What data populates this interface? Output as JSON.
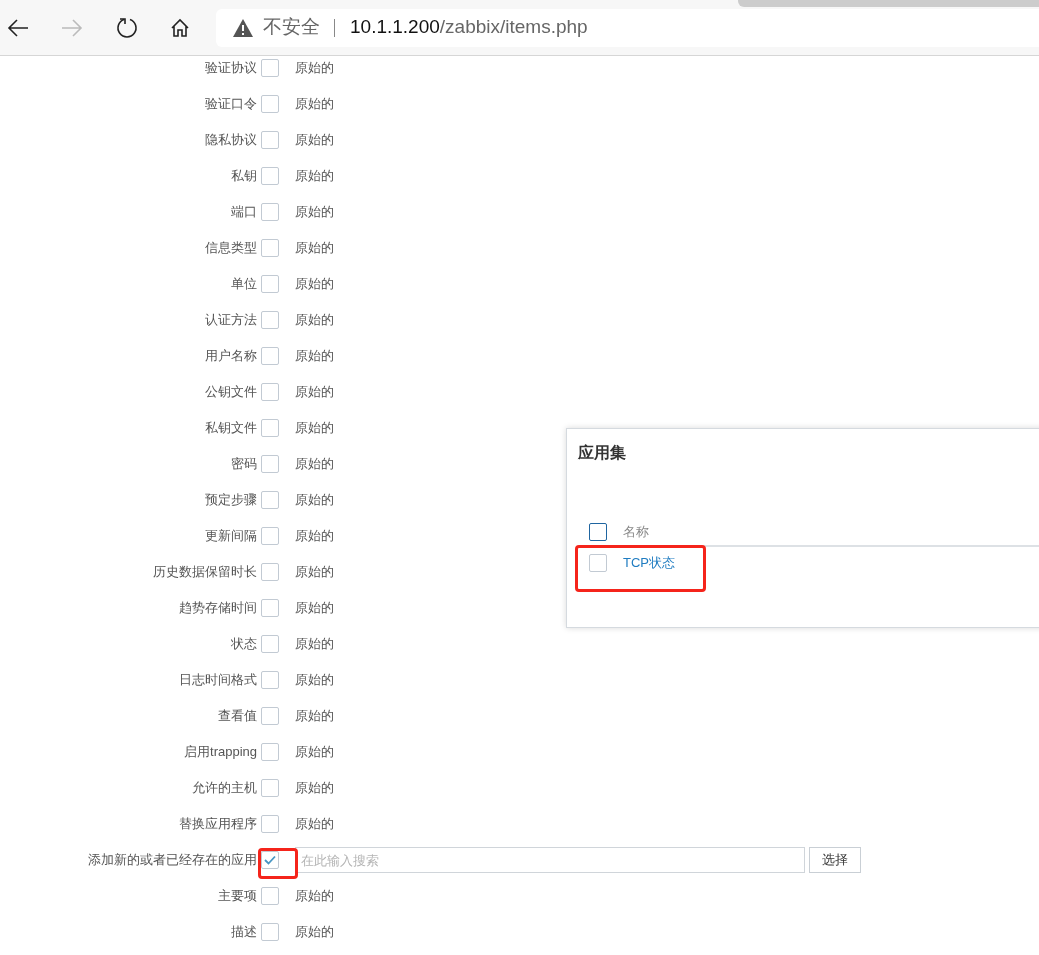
{
  "browser": {
    "security": "不安全",
    "url_host": "10.1.1.200",
    "url_path": "/zabbix/items.php"
  },
  "form": {
    "rows": [
      {
        "kind": "original",
        "label": "验证协议",
        "checked": false,
        "value": "原始的"
      },
      {
        "kind": "original",
        "label": "验证口令",
        "checked": false,
        "value": "原始的"
      },
      {
        "kind": "original",
        "label": "隐私协议",
        "checked": false,
        "value": "原始的"
      },
      {
        "kind": "original",
        "label": "私钥",
        "checked": false,
        "value": "原始的"
      },
      {
        "kind": "original",
        "label": "端口",
        "checked": false,
        "value": "原始的"
      },
      {
        "kind": "original",
        "label": "信息类型",
        "checked": false,
        "value": "原始的"
      },
      {
        "kind": "original",
        "label": "单位",
        "checked": false,
        "value": "原始的"
      },
      {
        "kind": "original",
        "label": "认证方法",
        "checked": false,
        "value": "原始的"
      },
      {
        "kind": "original",
        "label": "用户名称",
        "checked": false,
        "value": "原始的"
      },
      {
        "kind": "original",
        "label": "公钥文件",
        "checked": false,
        "value": "原始的"
      },
      {
        "kind": "original",
        "label": "私钥文件",
        "checked": false,
        "value": "原始的"
      },
      {
        "kind": "original",
        "label": "密码",
        "checked": false,
        "value": "原始的"
      },
      {
        "kind": "original",
        "label": "预定步骤",
        "checked": false,
        "value": "原始的"
      },
      {
        "kind": "original",
        "label": "更新间隔",
        "checked": false,
        "value": "原始的"
      },
      {
        "kind": "original",
        "label": "历史数据保留时长",
        "checked": false,
        "value": "原始的"
      },
      {
        "kind": "original",
        "label": "趋势存储时间",
        "checked": false,
        "value": "原始的"
      },
      {
        "kind": "original",
        "label": "状态",
        "checked": false,
        "value": "原始的"
      },
      {
        "kind": "original",
        "label": "日志时间格式",
        "checked": false,
        "value": "原始的"
      },
      {
        "kind": "original",
        "label": "查看值",
        "checked": false,
        "value": "原始的"
      },
      {
        "kind": "original",
        "label": "启用trapping",
        "checked": false,
        "value": "原始的"
      },
      {
        "kind": "original",
        "label": "允许的主机",
        "checked": false,
        "value": "原始的"
      },
      {
        "kind": "original",
        "label": "替换应用程序",
        "checked": false,
        "value": "原始的"
      },
      {
        "kind": "search",
        "label": "添加新的或者已经存在的应用",
        "checked": true,
        "placeholder": "在此输入搜索",
        "button": "选择"
      },
      {
        "kind": "original",
        "label": "主要项",
        "checked": false,
        "value": "原始的"
      },
      {
        "kind": "original",
        "label": "描述",
        "checked": false,
        "value": "原始的"
      }
    ]
  },
  "dialog": {
    "title": "应用集",
    "header": {
      "label": "名称",
      "checked": false
    },
    "rows": [
      {
        "name": "TCP状态",
        "checked": false
      }
    ]
  }
}
